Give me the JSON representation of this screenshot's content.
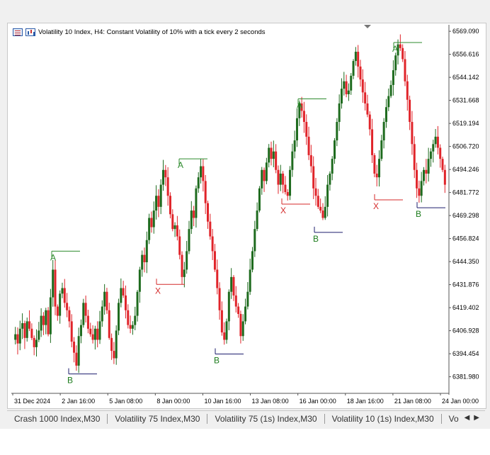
{
  "window": {
    "title": "Volatility 10 Index, H4:  Constant Volatility of 10% with a tick every 2 seconds"
  },
  "icons": {
    "list": "list-icon",
    "chart": "bar-chart-icon",
    "scroll_left": "triangle-left-icon",
    "scroll_right": "triangle-right-icon"
  },
  "tabs": [
    {
      "label": "Crash 1000 Index,M30"
    },
    {
      "label": "Volatility 75 Index,M30"
    },
    {
      "label": "Volatility 75 (1s) Index,M30"
    },
    {
      "label": "Volatility 10 (1s) Index,M30"
    },
    {
      "label": "Vo"
    }
  ],
  "colors": {
    "bull": "#1e6b1e",
    "bear": "#e0242a",
    "grid": "#ffffff",
    "marker_a": "#2e8b2e",
    "marker_x": "#d42a2a",
    "marker_b": "#1a7a1a",
    "line_b": "#1c1c6e"
  },
  "chart_data": {
    "type": "candlestick",
    "symbol": "Volatility 10 Index",
    "timeframe": "H4",
    "y_ticks": [
      "6569.090",
      "6556.616",
      "6544.142",
      "6531.668",
      "6519.194",
      "6506.720",
      "6494.246",
      "6481.772",
      "6469.298",
      "6456.824",
      "6444.350",
      "6431.876",
      "6419.402",
      "6406.928",
      "6394.454",
      "6381.980"
    ],
    "x_ticks": [
      "31 Dec 2024",
      "2 Jan 16:00",
      "5 Jan 08:00",
      "8 Jan 00:00",
      "10 Jan 16:00",
      "13 Jan 08:00",
      "16 Jan 00:00",
      "18 Jan 16:00",
      "21 Jan 08:00",
      "24 Jan 00:00"
    ],
    "ylim": [
      6373.0,
      6572.6
    ],
    "signals": [
      {
        "label": "A",
        "price": 6450.0
      },
      {
        "label": "B",
        "price": 6383.5
      },
      {
        "label": "X",
        "price": 6432.0
      },
      {
        "label": "A",
        "price": 6500.0
      },
      {
        "label": "B",
        "price": 6394.3
      },
      {
        "label": "X",
        "price": 6475.5
      },
      {
        "label": "A",
        "price": 6532.5
      },
      {
        "label": "B",
        "price": 6460.2
      },
      {
        "label": "X",
        "price": 6477.8
      },
      {
        "label": "A",
        "price": 6563.0
      },
      {
        "label": "B",
        "price": 6473.5
      }
    ],
    "close": [
      6405,
      6400,
      6408,
      6411,
      6403,
      6412,
      6408,
      6403,
      6398,
      6402,
      6407,
      6415,
      6410,
      6418,
      6405,
      6425,
      6440,
      6420,
      6415,
      6427,
      6430,
      6422,
      6418,
      6412,
      6401,
      6395,
      6388,
      6404,
      6410,
      6422,
      6415,
      6408,
      6405,
      6402,
      6408,
      6402,
      6412,
      6420,
      6428,
      6418,
      6403,
      6396,
      6392,
      6407,
      6422,
      6430,
      6426,
      6418,
      6410,
      6408,
      6410,
      6415,
      6428,
      6440,
      6448,
      6444,
      6456,
      6468,
      6463,
      6472,
      6480,
      6474,
      6486,
      6494,
      6490,
      6480,
      6470,
      6462,
      6464,
      6458,
      6448,
      6436,
      6440,
      6450,
      6462,
      6472,
      6468,
      6484,
      6490,
      6496,
      6488,
      6476,
      6466,
      6458,
      6450,
      6440,
      6430,
      6418,
      6406,
      6402,
      6412,
      6428,
      6436,
      6426,
      6420,
      6416,
      6404,
      6412,
      6420,
      6428,
      6440,
      6450,
      6462,
      6472,
      6484,
      6494,
      6488,
      6498,
      6506,
      6500,
      6504,
      6494,
      6486,
      6492,
      6486,
      6482,
      6480,
      6494,
      6504,
      6510,
      6522,
      6530,
      6526,
      6520,
      6512,
      6502,
      6496,
      6484,
      6480,
      6474,
      6472,
      6468,
      6474,
      6486,
      6492,
      6500,
      6510,
      6520,
      6530,
      6538,
      6542,
      6535,
      6537,
      6545,
      6553,
      6558,
      6550,
      6543,
      6536,
      6530,
      6524,
      6516,
      6502,
      6492,
      6490,
      6500,
      6510,
      6520,
      6528,
      6534,
      6540,
      6548,
      6556,
      6562,
      6560,
      6554,
      6542,
      6532,
      6520,
      6508,
      6494,
      6484,
      6480,
      6488,
      6494,
      6492,
      6500,
      6504,
      6508,
      6512,
      6506,
      6500,
      6494,
      6486
    ]
  }
}
